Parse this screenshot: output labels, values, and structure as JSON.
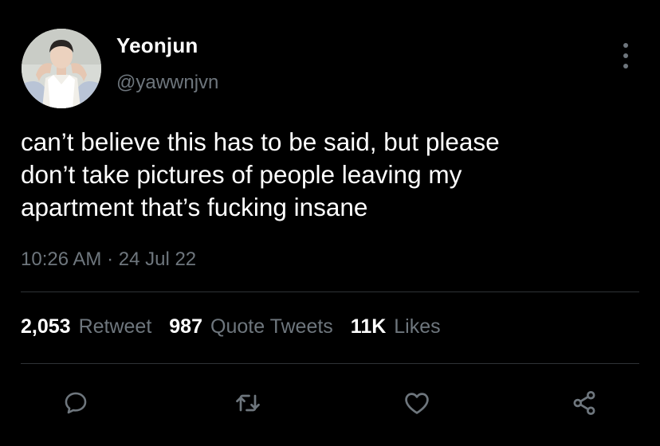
{
  "tweet": {
    "display_name": "Yeonjun",
    "handle": "@yawwnjvn",
    "text": "can’t believe this has to be said, but please\ndon’t take pictures of people leaving my\napartment that’s fucking insane",
    "timestamp": "10:26 AM · 24 Jul 22"
  },
  "stats": {
    "retweets_count": "2,053",
    "retweets_label": "Retweet",
    "quotes_count": "987",
    "quotes_label": "Quote Tweets",
    "likes_count": "11K",
    "likes_label": "Likes"
  },
  "icons": {
    "more": "more-vertical-icon",
    "reply": "reply-icon",
    "retweet": "retweet-icon",
    "like": "heart-icon",
    "share": "share-icon"
  },
  "colors": {
    "background": "#000000",
    "primary_text": "#ffffff",
    "secondary_text": "#6e767d",
    "divider": "#2f3336"
  }
}
